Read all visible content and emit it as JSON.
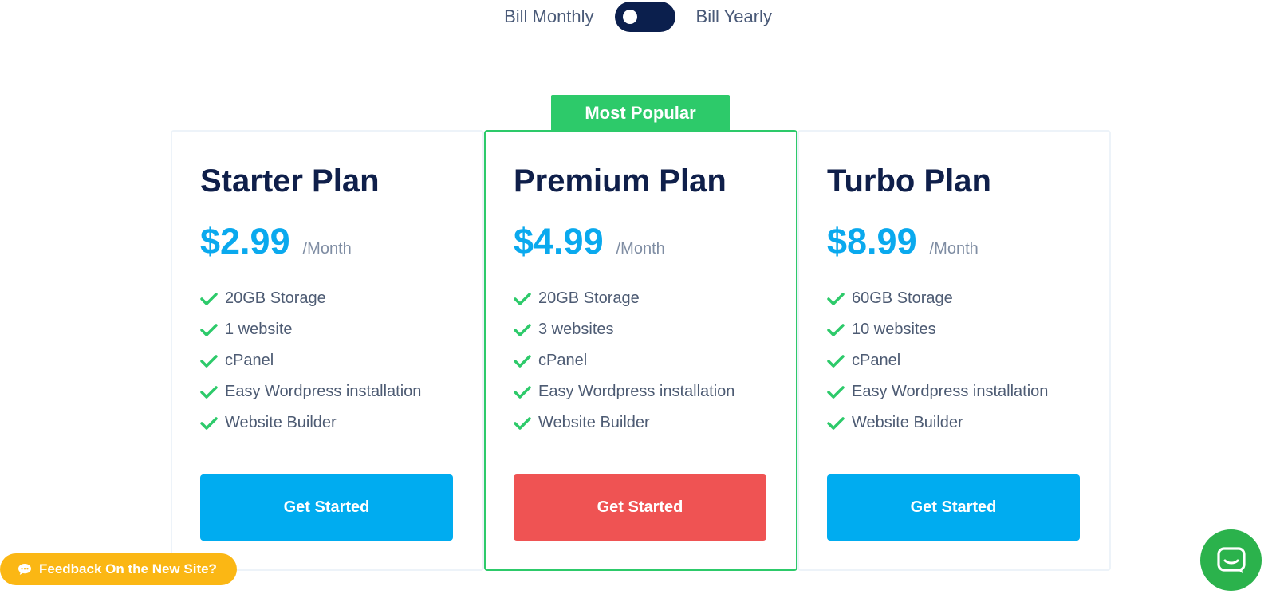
{
  "billing": {
    "monthly_label": "Bill Monthly",
    "yearly_label": "Bill Yearly",
    "toggle_state": "monthly"
  },
  "badge": {
    "label": "Most Popular"
  },
  "plans": [
    {
      "name": "Starter Plan",
      "price": "$2.99",
      "period": "/Month",
      "features": [
        "20GB Storage",
        "1 website",
        "cPanel",
        "Easy Wordpress installation",
        "Website Builder"
      ],
      "cta": "Get Started"
    },
    {
      "name": "Premium Plan",
      "price": "$4.99",
      "period": "/Month",
      "features": [
        "20GB Storage",
        "3 websites",
        "cPanel",
        "Easy Wordpress installation",
        "Website Builder"
      ],
      "cta": "Get Started"
    },
    {
      "name": "Turbo Plan",
      "price": "$8.99",
      "period": "/Month",
      "features": [
        "60GB Storage",
        "10 websites",
        "cPanel",
        "Easy Wordpress installation",
        "Website Builder"
      ],
      "cta": "Get Started"
    }
  ],
  "feedback": {
    "label": "Feedback On the New Site?"
  },
  "colors": {
    "accent_blue": "#00acf0",
    "accent_red": "#ef5353",
    "accent_green": "#2dca6a",
    "feedback_yellow": "#fbb714",
    "chat_green": "#2bb24c",
    "navy": "#0f1f4a"
  },
  "icons": {
    "feature_check": "check-icon",
    "feedback": "chat-bubble-icon",
    "launcher": "chat-icon"
  }
}
